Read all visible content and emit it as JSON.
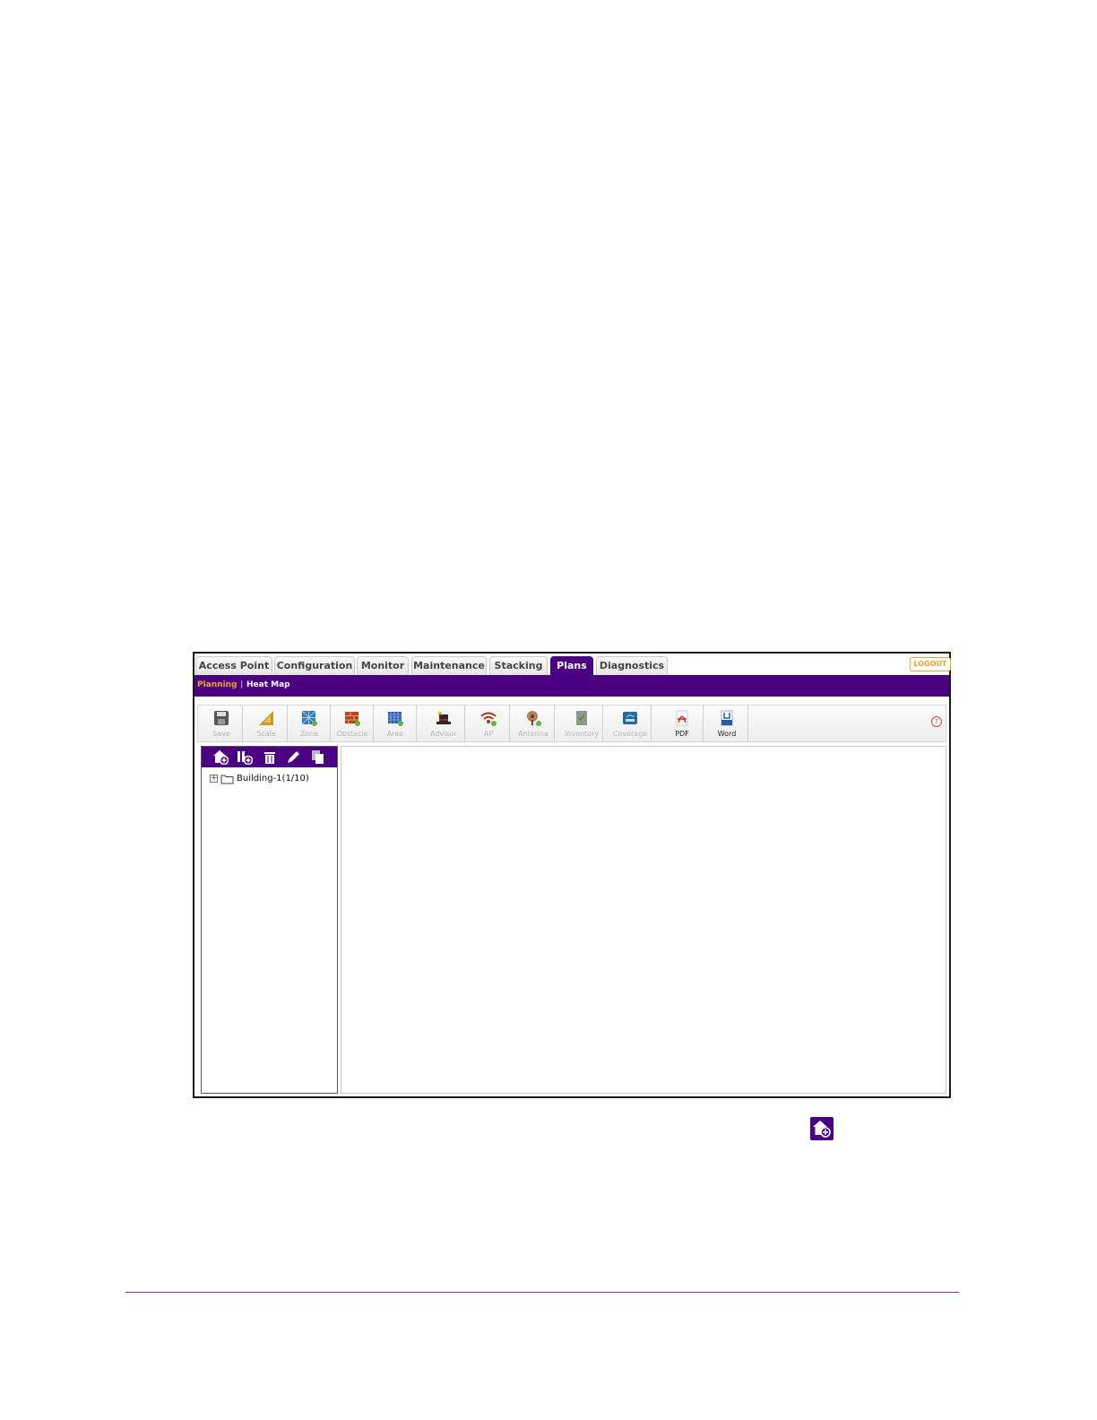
{
  "tabs": [
    {
      "label": "Access Point"
    },
    {
      "label": "Configuration"
    },
    {
      "label": "Monitor"
    },
    {
      "label": "Maintenance"
    },
    {
      "label": "Stacking"
    },
    {
      "label": "Plans"
    },
    {
      "label": "Diagnostics"
    }
  ],
  "active_tab": "Plans",
  "logout_label": "LOGOUT",
  "subnav": {
    "planning": "Planning",
    "separator": "|",
    "heat_map": "Heat Map"
  },
  "toolbar": [
    {
      "label": "Save",
      "icon": "save-icon",
      "enabled": false
    },
    {
      "label": "Scale",
      "icon": "scale-icon",
      "enabled": false
    },
    {
      "label": "Zone",
      "icon": "zone-icon",
      "enabled": false
    },
    {
      "label": "Obstacle",
      "icon": "obstacle-icon",
      "enabled": false
    },
    {
      "label": "Area",
      "icon": "area-icon",
      "enabled": false
    },
    {
      "label": "Advisor",
      "icon": "advisor-icon",
      "enabled": false
    },
    {
      "label": "AP",
      "icon": "ap-icon",
      "enabled": false
    },
    {
      "label": "Antenna",
      "icon": "antenna-icon",
      "enabled": false
    },
    {
      "label": "Inventory",
      "icon": "inventory-icon",
      "enabled": false
    },
    {
      "label": "Coverage",
      "icon": "coverage-icon",
      "enabled": false
    },
    {
      "label": "PDF",
      "icon": "pdf-icon",
      "enabled": true
    },
    {
      "label": "Word",
      "icon": "word-icon",
      "enabled": true
    }
  ],
  "help_glyph": "?",
  "tree": {
    "items": [
      {
        "label": "Building-1(1/10)",
        "expand_glyph": "+"
      }
    ]
  },
  "colors": {
    "brand_purple": "#4b0082",
    "accent_orange": "#f0a030",
    "footer_rule": "#7a3aa0"
  }
}
